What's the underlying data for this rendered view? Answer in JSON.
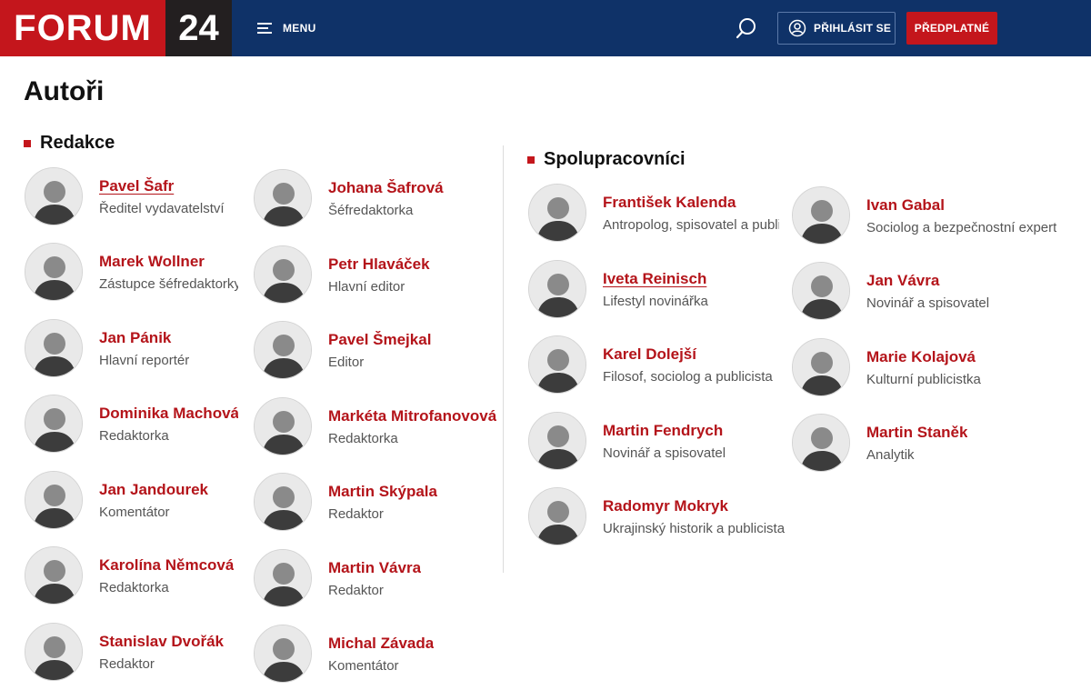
{
  "header": {
    "logo_main": "FORUM",
    "logo_num": "24",
    "menu_label": "MENU",
    "login_label": "PŘIHLÁSIT SE",
    "subscribe_label": "PŘEDPLATNÉ",
    "colors": {
      "bar": "#0f3268",
      "brand_red": "#c4161c",
      "logo_dark": "#231f20"
    }
  },
  "page_title": "Autoři",
  "redakce": {
    "heading": "Redakce",
    "left": [
      {
        "name": "Pavel Šafr",
        "role": "Ředitel vydavatelství"
      },
      {
        "name": "Marek Wollner",
        "role": "Zástupce šéfredaktorky"
      },
      {
        "name": "Jan Pánik",
        "role": "Hlavní reportér"
      },
      {
        "name": "Dominika Machová",
        "role": "Redaktorka"
      },
      {
        "name": "Jan Jandourek",
        "role": "Komentátor"
      },
      {
        "name": "Karolína Němcová",
        "role": "Redaktorka"
      },
      {
        "name": "Stanislav Dvořák",
        "role": "Redaktor"
      }
    ],
    "right": [
      {
        "name": "Johana Šafrová",
        "role": "Šéfredaktorka"
      },
      {
        "name": "Petr Hlaváček",
        "role": "Hlavní editor"
      },
      {
        "name": "Pavel Šmejkal",
        "role": "Editor"
      },
      {
        "name": "Markéta Mitrofanovová",
        "role": "Redaktorka"
      },
      {
        "name": "Martin Skýpala",
        "role": "Redaktor"
      },
      {
        "name": "Martin Vávra",
        "role": "Redaktor"
      },
      {
        "name": "Michal Závada",
        "role": "Komentátor"
      }
    ]
  },
  "spolupracovnici": {
    "heading": "Spolupracovníci",
    "left": [
      {
        "name": "František Kalenda",
        "role": "Antropolog, spisovatel a publicista"
      },
      {
        "name": "Iveta Reinisch",
        "role": "Lifestyl novinářka"
      },
      {
        "name": "Karel Dolejší",
        "role": "Filosof, sociolog a publicista"
      },
      {
        "name": "Martin Fendrych",
        "role": "Novinář a spisovatel"
      },
      {
        "name": "Radomyr Mokryk",
        "role": "Ukrajinský historik a publicista"
      }
    ],
    "right": [
      {
        "name": "Ivan Gabal",
        "role": "Sociolog a bezpečnostní expert"
      },
      {
        "name": "Jan Vávra",
        "role": "Novinář a spisovatel"
      },
      {
        "name": "Marie Kolajová",
        "role": "Kulturní publicistka"
      },
      {
        "name": "Martin Staněk",
        "role": "Analytik"
      }
    ]
  }
}
